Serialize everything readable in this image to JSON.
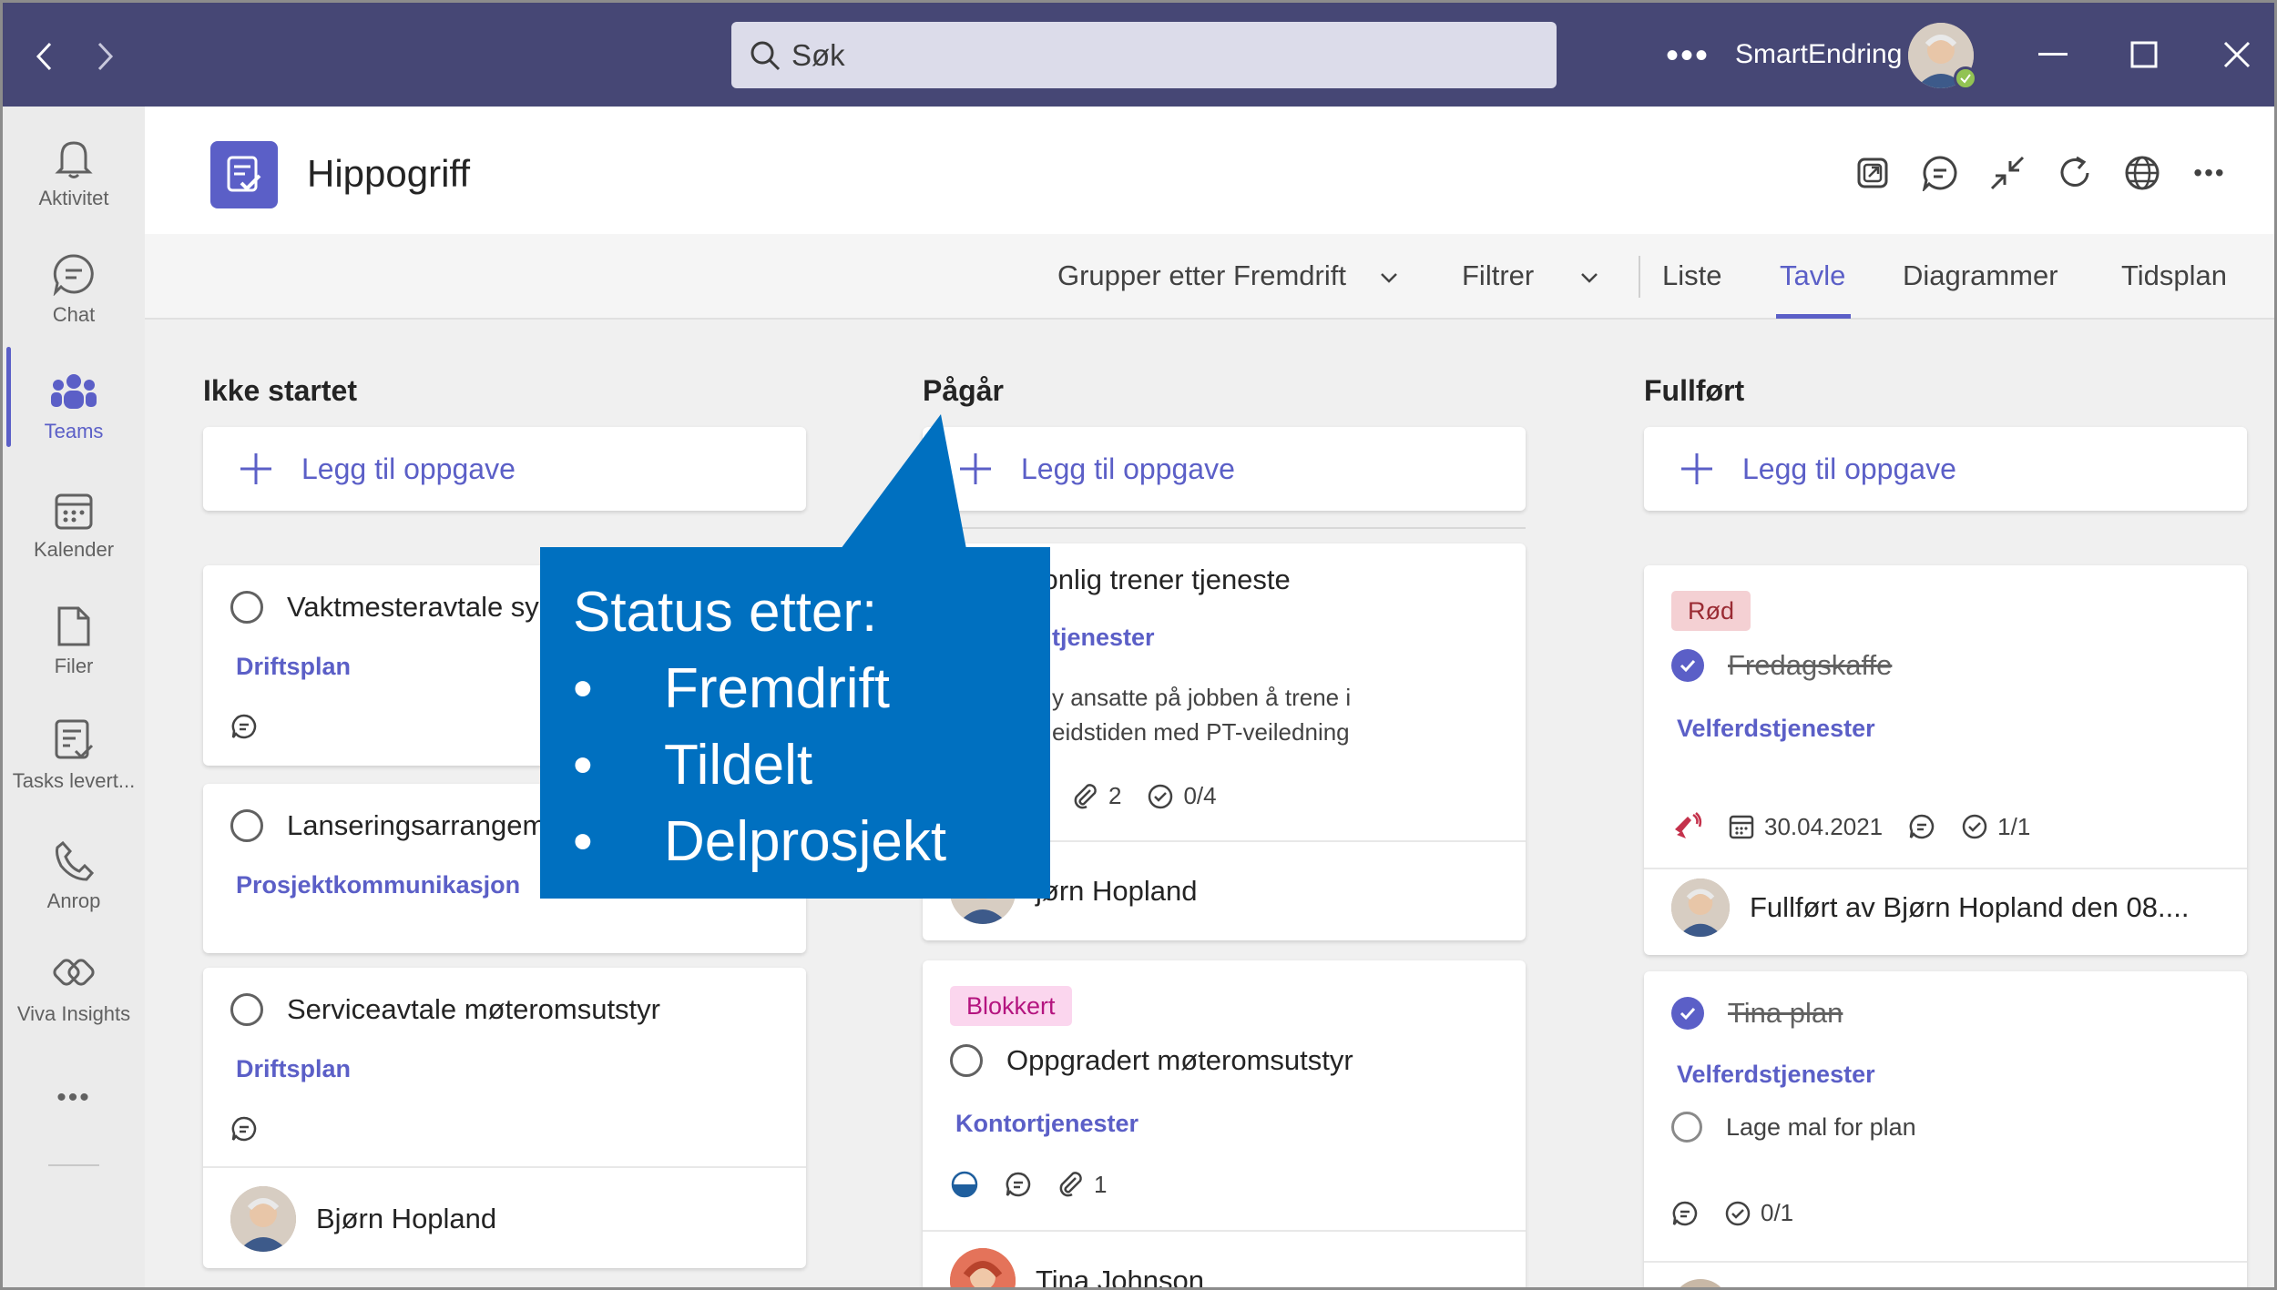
{
  "titlebar": {
    "search_placeholder": "Søk",
    "more_label": "•••",
    "org_name": "SmartEndring"
  },
  "rail": {
    "items": [
      {
        "label": "Aktivitet",
        "icon": "bell-icon"
      },
      {
        "label": "Chat",
        "icon": "chat-icon"
      },
      {
        "label": "Teams",
        "icon": "teams-icon",
        "active": true
      },
      {
        "label": "Kalender",
        "icon": "calendar-icon"
      },
      {
        "label": "Filer",
        "icon": "file-icon"
      },
      {
        "label": "Tasks levert...",
        "icon": "tasks-icon"
      },
      {
        "label": "Anrop",
        "icon": "phone-icon"
      },
      {
        "label": "Viva Insights",
        "icon": "insights-icon"
      }
    ],
    "more_label": "•••"
  },
  "header": {
    "title": "Hippogriff",
    "more_label": "•••"
  },
  "toolbar": {
    "group_by": "Grupper etter Fremdrift",
    "filter": "Filtrer",
    "tabs": [
      "Liste",
      "Tavle",
      "Diagrammer",
      "Tidsplan"
    ],
    "active_tab": "Tavle"
  },
  "board": {
    "add_task_label": "Legg til oppgave",
    "columns": [
      {
        "title": "Ikke startet",
        "cards": [
          {
            "title": "Vaktmesteravtale sy",
            "bucket": "Driftsplan"
          },
          {
            "title": "Lanseringsarrangem",
            "bucket": "Prosjektkommunikasjon"
          },
          {
            "title": "Serviceavtale møteromsutstyr",
            "bucket": "Driftsplan",
            "assignee": "Bjørn Hopland"
          }
        ]
      },
      {
        "title": "Pågår",
        "cards": [
          {
            "title": "sonlig trener tjeneste",
            "bucket": "tjenester",
            "note_line1": "y ansatte på jobben å trene i",
            "note_line2": "eidstiden med PT-veiledning",
            "attachments": "2",
            "checklist": "0/4",
            "assignee": "jørn Hopland"
          },
          {
            "label": "Blokkert",
            "title": "Oppgradert møteromsutstyr",
            "bucket": "Kontortjenester",
            "attachments": "1",
            "assignee": "Tina Johnson"
          }
        ]
      },
      {
        "title": "Fullført",
        "cards": [
          {
            "label": "Rød",
            "title": "Fredagskaffe",
            "bucket": "Velferdstjenester",
            "due": "30.04.2021",
            "checklist": "1/1",
            "completed_by": "Fullført av Bjørn Hopland den 08...."
          },
          {
            "title": "Tina plan",
            "bucket": "Velferdstjenester",
            "subtask": "Lage mal for plan",
            "checklist": "0/1"
          }
        ]
      }
    ]
  },
  "callout": {
    "heading": "Status etter:",
    "items": [
      "Fremdrift",
      "Tildelt",
      "Delprosjekt"
    ],
    "color": "#0070c0"
  },
  "colors": {
    "titlebar": "#464775",
    "accent": "#5b5fc7",
    "label_red": "#f4d0d3",
    "label_blocked": "#fbd6ee"
  }
}
